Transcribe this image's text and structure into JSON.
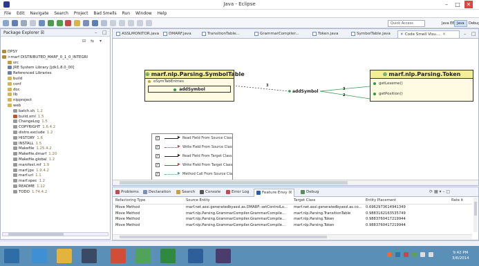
{
  "window": {
    "title": "Java - Eclipse",
    "controls": {
      "minimize": "–",
      "maximize": "□",
      "close": "✕"
    }
  },
  "menu": [
    "File",
    "Edit",
    "Navigate",
    "Search",
    "Project",
    "Bad Smells",
    "Run",
    "Window",
    "Help"
  ],
  "toolbar": {
    "quick_access_placeholder": "Quick Access",
    "perspectives": [
      "Java EE",
      "Java",
      "Debug"
    ]
  },
  "package_explorer": {
    "title": "Package Explorer ☒",
    "tree": [
      {
        "label": "DPSY",
        "version": "",
        "indent": 0,
        "icon_color": "#b08a3c"
      },
      {
        "label": ">marf DISTRIBUTED_MARF_0_1_0_INTEGRI",
        "version": "",
        "indent": 0,
        "icon_color": "#b08a3c"
      },
      {
        "label": "src",
        "version": "",
        "indent": 1,
        "icon_color": "#c89b3c"
      },
      {
        "label": "JRE System Library [jdk1.8.0_00]",
        "version": "",
        "indent": 1,
        "icon_color": "#6a7fb0"
      },
      {
        "label": "Referenced Libraries",
        "version": "",
        "indent": 1,
        "icon_color": "#6a7fb0"
      },
      {
        "label": "build",
        "version": "",
        "indent": 1,
        "icon_color": "#d9b44a"
      },
      {
        "label": "conf",
        "version": "",
        "indent": 1,
        "icon_color": "#d9b44a"
      },
      {
        "label": "doc",
        "version": "",
        "indent": 1,
        "icon_color": "#d9b44a"
      },
      {
        "label": "lib",
        "version": "",
        "indent": 1,
        "icon_color": "#d9b44a"
      },
      {
        "label": "nlpproject",
        "version": "",
        "indent": 1,
        "icon_color": "#d9b44a"
      },
      {
        "label": "web",
        "version": "",
        "indent": 1,
        "icon_color": "#d9b44a"
      },
      {
        "label": "batch.sh",
        "version": "1.2",
        "indent": 2,
        "icon_color": "#999999"
      },
      {
        "label": "build.xml",
        "version": "1.5",
        "indent": 2,
        "icon_color": "#c0552b"
      },
      {
        "label": "ChangeLog",
        "version": "1.5",
        "indent": 2,
        "icon_color": "#999999"
      },
      {
        "label": "COPYRIGHT",
        "version": "1.6.4.2",
        "indent": 2,
        "icon_color": "#999999"
      },
      {
        "label": "distro.exclude",
        "version": "1.2",
        "indent": 2,
        "icon_color": "#999999"
      },
      {
        "label": "HISTORY",
        "version": "1.6",
        "indent": 2,
        "icon_color": "#999999"
      },
      {
        "label": "INSTALL",
        "version": "1.5",
        "indent": 2,
        "icon_color": "#999999"
      },
      {
        "label": "Makefile",
        "version": "1.25.4.2",
        "indent": 2,
        "icon_color": "#999999"
      },
      {
        "label": "Makefile.dmarf",
        "version": "1.20",
        "indent": 2,
        "icon_color": "#999999"
      },
      {
        "label": "Makefile.global",
        "version": "1.2",
        "indent": 2,
        "icon_color": "#999999"
      },
      {
        "label": "manifest.mf",
        "version": "1.9",
        "indent": 2,
        "icon_color": "#999999"
      },
      {
        "label": "marf.jpx",
        "version": "1.9.4.2",
        "indent": 2,
        "icon_color": "#999999"
      },
      {
        "label": "marf.url",
        "version": "1.1",
        "indent": 2,
        "icon_color": "#999999"
      },
      {
        "label": "marf.spec",
        "version": "1.2",
        "indent": 2,
        "icon_color": "#999999"
      },
      {
        "label": "README",
        "version": "1.12",
        "indent": 2,
        "icon_color": "#999999"
      },
      {
        "label": "TODO",
        "version": "1.74.4.2",
        "indent": 2,
        "icon_color": "#999999"
      }
    ]
  },
  "editor": {
    "tabs": [
      {
        "label": "ASSLMONITOR.java"
      },
      {
        "label": "DMARF.java"
      },
      {
        "label": "TransitionTable..."
      },
      {
        "label": "GrammarCompiler..."
      },
      {
        "label": "Token.java"
      },
      {
        "label": "SymbolTable.java"
      },
      {
        "label": "Code Smell Visu..."
      }
    ],
    "diagram": {
      "class_left": {
        "name": "marf.nlp.Parsing.SymbolTable",
        "field": "oSymTabEntries",
        "method": "addSymbol"
      },
      "class_right": {
        "name": "marf.nlp.Parsing.Token",
        "methods": [
          "getLexeme()",
          "getPosition()"
        ]
      },
      "free_method": "addSymbol",
      "edge_labels": [
        "3",
        "3",
        "2"
      ]
    },
    "legend": [
      {
        "label": "Read Field From Source Class",
        "color": "#222222",
        "style": "solid",
        "checked": true
      },
      {
        "label": "Write Field From Source Class",
        "color": "#d33333",
        "style": "dotted",
        "checked": true
      },
      {
        "label": "Read Field From Target Class",
        "color": "#222222",
        "style": "solid",
        "checked": true
      },
      {
        "label": "Write Field From Target Class",
        "color": "#d33333",
        "style": "solid",
        "checked": true
      },
      {
        "label": "Method Call From Source Class",
        "color": "#3aa0a0",
        "style": "dotted",
        "checked": true
      },
      {
        "label": "Method Call From Target Class",
        "color": "#3aa0a0",
        "style": "dashed",
        "checked": true
      }
    ]
  },
  "bottom_panel": {
    "tabs": [
      {
        "label": "Problems",
        "color": "#c04b4b"
      },
      {
        "label": "Declaration",
        "color": "#7a8fb5"
      },
      {
        "label": "Search",
        "color": "#c9a13b"
      },
      {
        "label": "Console",
        "color": "#555555"
      },
      {
        "label": "Error Log",
        "color": "#c04b4b"
      },
      {
        "label": "Feature Envy ☒",
        "color": "#2b5aa8"
      },
      {
        "label": "Debug",
        "color": "#5a8c5a"
      }
    ],
    "columns": [
      "Refactoring Type",
      "Source Entity",
      "Target Class",
      "Entity Placement",
      "Rate it"
    ],
    "rows": [
      [
        "Move Method",
        "marf.net.assi.generatedbyassl.as.DMARF::setControlLo...",
        "marf.net.assl.generatedbyassl.as.co...",
        "0.6962973614941349",
        ""
      ],
      [
        "Move Method",
        "marf.nlp.Parsing.GrammarCompiler.GrammarCompile...",
        "marf.nlp.Parsing.TransitionTable",
        "0.9883162163535749",
        ""
      ],
      [
        "Move Method",
        "marf.nlp.Parsing.GrammarCompiler.GrammarCompile...",
        "marf.nlp.Parsing.Token",
        "0.9883760417219944",
        ""
      ],
      [
        "Move Method",
        "marf.nlp.Parsing.GrammarCompiler.GrammarCompile...",
        "marf.nlp.Parsing.Token",
        "0.9883760417219944",
        ""
      ]
    ]
  },
  "taskbar": {
    "apps": [
      {
        "name": "start",
        "color": "#2f6da6"
      },
      {
        "name": "ie",
        "color": "#3f8fd4"
      },
      {
        "name": "explorer",
        "color": "#e3b43d"
      },
      {
        "name": "media",
        "color": "#3b4a63"
      },
      {
        "name": "chrome",
        "color": "#d24d36"
      },
      {
        "name": "app-green",
        "color": "#4fa35a"
      },
      {
        "name": "app-green2",
        "color": "#2f8a3f"
      },
      {
        "name": "app-blue",
        "color": "#2f5f9a"
      },
      {
        "name": "eclipse",
        "color": "#4a3c6b"
      }
    ],
    "time": "9:42 PM",
    "date": "3/6/2014"
  }
}
